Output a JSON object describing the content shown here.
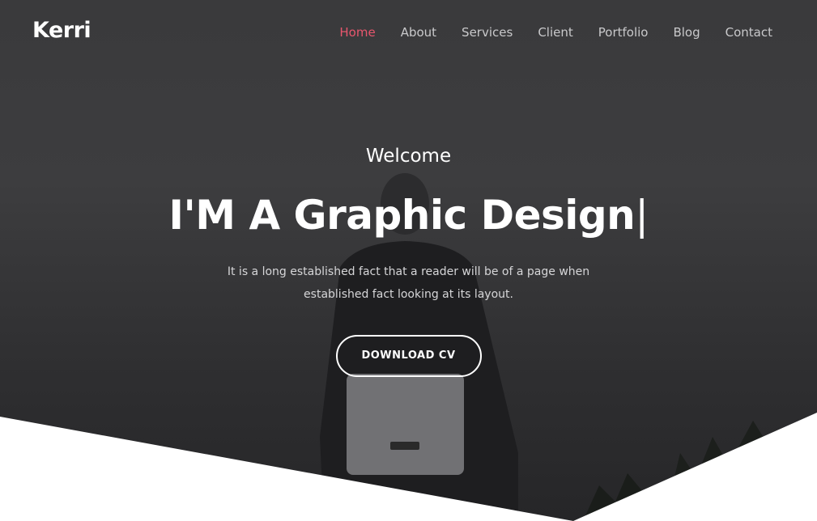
{
  "brand": {
    "logo": "Kerri"
  },
  "nav": {
    "items": [
      {
        "label": "Home",
        "active": true
      },
      {
        "label": "About",
        "active": false
      },
      {
        "label": "Services",
        "active": false
      },
      {
        "label": "Client",
        "active": false
      },
      {
        "label": "Portfolio",
        "active": false
      },
      {
        "label": "Blog",
        "active": false
      },
      {
        "label": "Contact",
        "active": false
      }
    ]
  },
  "hero": {
    "welcome": "Welcome",
    "headline": "I'M A Graphic Design",
    "cursor": "|",
    "description": "It is a long established fact that a reader will be of a page when established fact looking at its layout.",
    "button_label": "DOWNLOAD CV"
  },
  "colors": {
    "accent": "#e8566d",
    "hero_overlay": "#3a3a3c",
    "text_light": "#ffffff",
    "nav_text": "#c9c9cb"
  }
}
